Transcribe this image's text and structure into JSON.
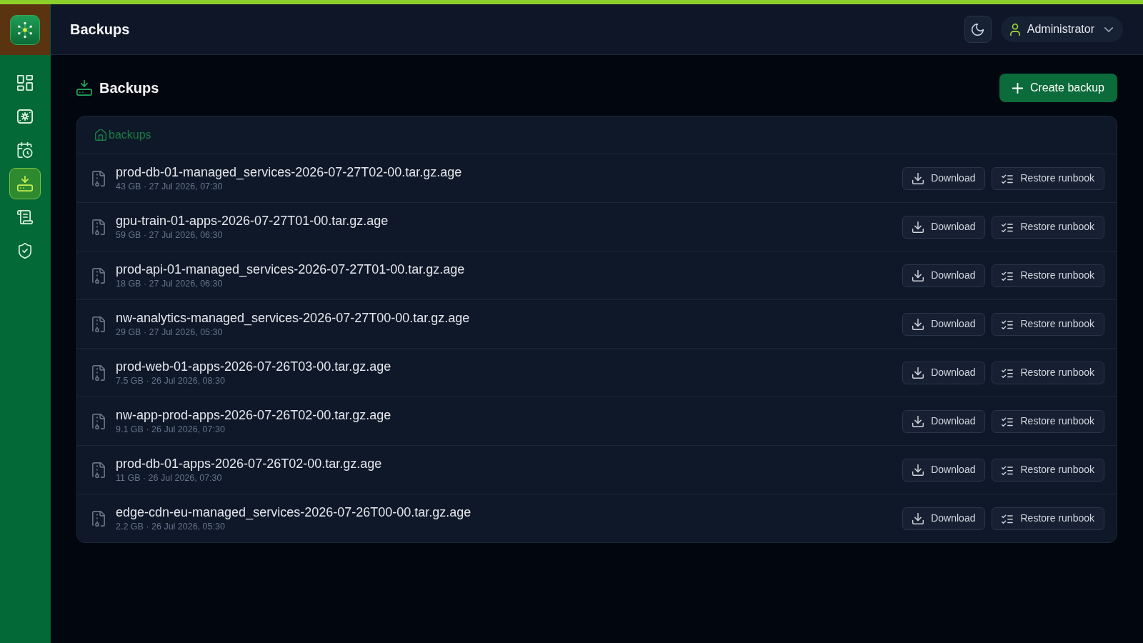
{
  "sidebar": {
    "items": [
      {
        "selected": false
      },
      {
        "selected": false
      },
      {
        "selected": false
      },
      {
        "selected": true
      },
      {
        "selected": false
      },
      {
        "selected": false
      }
    ]
  },
  "header": {
    "title": "Backups",
    "user": "Administrator"
  },
  "page": {
    "title": "Backups",
    "create_button": "Create backup"
  },
  "breadcrumb": [
    "backups"
  ],
  "backups": [
    {
      "name": "prod-db-01-managed_services-2026-07-27T02-00.tar.gz.age",
      "details": "43 GB · 27 Jul 2026, 07:30",
      "actions": [
        "Download",
        "Restore runbook"
      ]
    },
    {
      "name": "gpu-train-01-apps-2026-07-27T01-00.tar.gz.age",
      "details": "59 GB · 27 Jul 2026, 06:30",
      "actions": [
        "Download",
        "Restore runbook"
      ]
    },
    {
      "name": "prod-api-01-managed_services-2026-07-27T01-00.tar.gz.age",
      "details": "18 GB · 27 Jul 2026, 06:30",
      "actions": [
        "Download",
        "Restore runbook"
      ]
    },
    {
      "name": "nw-analytics-managed_services-2026-07-27T00-00.tar.gz.age",
      "details": "29 GB · 27 Jul 2026, 05:30",
      "actions": [
        "Download",
        "Restore runbook"
      ]
    },
    {
      "name": "prod-web-01-apps-2026-07-26T03-00.tar.gz.age",
      "details": "7.5 GB · 26 Jul 2026, 08:30",
      "actions": [
        "Download",
        "Restore runbook"
      ]
    },
    {
      "name": "nw-app-prod-apps-2026-07-26T02-00.tar.gz.age",
      "details": "9.1 GB · 26 Jul 2026, 07:30",
      "actions": [
        "Download",
        "Restore runbook"
      ]
    },
    {
      "name": "prod-db-01-apps-2026-07-26T02-00.tar.gz.age",
      "details": "11 GB · 26 Jul 2026, 07:30",
      "actions": [
        "Download",
        "Restore runbook"
      ]
    },
    {
      "name": "edge-cdn-eu-managed_services-2026-07-26T00-00.tar.gz.age",
      "details": "2.2 GB · 26 Jul 2026, 05:30",
      "actions": [
        "Download",
        "Restore runbook"
      ]
    }
  ]
}
